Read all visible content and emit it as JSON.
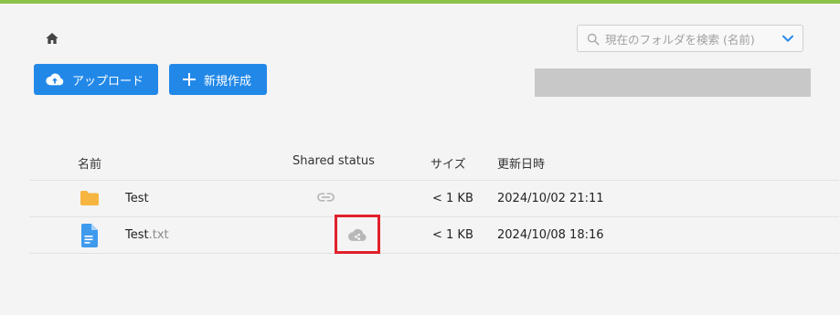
{
  "search": {
    "placeholder": "現在のフォルダを検索 (名前)"
  },
  "toolbar": {
    "upload_label": "アップロード",
    "new_label": "新規作成"
  },
  "table": {
    "headers": {
      "name": "名前",
      "shared_status": "Shared status",
      "size": "サイズ",
      "updated": "更新日時"
    },
    "rows": [
      {
        "name": "Test",
        "ext": "",
        "shared_icon": "link-icon",
        "size": "< 1 KB",
        "updated": "2024/10/02 21:11"
      },
      {
        "name": "Test",
        "ext": ".txt",
        "shared_icon": "cloud-share-icon",
        "size": "< 1 KB",
        "updated": "2024/10/08 18:16"
      }
    ]
  },
  "colors": {
    "accent": "#2288e8",
    "topbar": "#8bc34a",
    "folder": "#f6b540",
    "file": "#3f9aee",
    "highlight": "#e0202a"
  }
}
